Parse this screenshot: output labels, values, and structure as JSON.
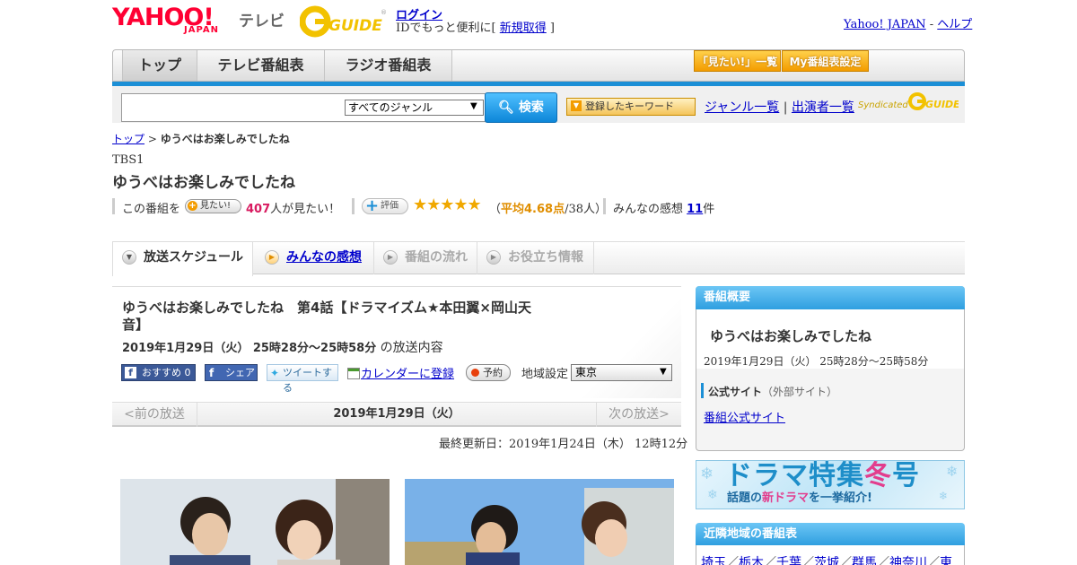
{
  "header": {
    "logo_yahoo": "YAHOO!",
    "logo_japan": "JAPAN",
    "logo_tv": "テレビ",
    "logo_gguide": "G-GUIDE",
    "login_link": "ログイン",
    "login_sub_prefix": "IDでもっと便利に[ ",
    "register_link": "新規取得",
    "login_sub_suffix": " ]",
    "yahoo_japan_link": "Yahoo! JAPAN",
    "separator": " - ",
    "help_link": "ヘルプ"
  },
  "global_nav": {
    "tabs": [
      "トップ",
      "テレビ番組表",
      "ラジオ番組表"
    ],
    "mitai_list": "「見たい!」一覧",
    "my_settings": "My番組表設定"
  },
  "search": {
    "genre_selected": "すべてのジャンル",
    "button": "検索",
    "registered_keywords": "登録したキーワード",
    "genre_list": "ジャンル一覧",
    "divider": " | ",
    "cast_list": "出演者一覧",
    "syndicated": "Syndicated"
  },
  "breadcrumb": {
    "top": "トップ",
    "sep": " > ",
    "current": "ゆうべはお楽しみでしたね"
  },
  "program": {
    "channel": "TBS1",
    "title": "ゆうべはお楽しみでしたね",
    "mitai_prefix": "この番組を",
    "mitai_button": "見たい!",
    "mitai_count": "407",
    "mitai_suffix": "人が見たい！",
    "rate_button": "評価",
    "stars": "★★★★★",
    "rating_open": "（",
    "rating_average": "平均4.68点",
    "rating_people": "/38人）",
    "impressions_prefix": "みんなの感想 ",
    "impressions_count": "11",
    "impressions_suffix": "件"
  },
  "tabs": {
    "schedule": "放送スケジュール",
    "impressions": "みんなの感想",
    "flow": "番組の流れ",
    "info": "お役立ち情報"
  },
  "episode": {
    "title": "ゆうべはお楽しみでしたね　第4話【ドラマイズム★本田翼×岡山天音】",
    "time": "2019年1月29日（火）  25時28分～25時58分",
    "time_suffix": " の放送内容",
    "fb_recommend": "おすすめ 0",
    "fb_share": "シェア",
    "tweet": "ツイートする",
    "calendar": "カレンダーに登録",
    "reserve": "予約",
    "region_label": "地域設定",
    "region_selected": "東京",
    "prev": "<前の放送",
    "date": "2019年1月29日（火）",
    "next": "次の放送>",
    "last_updated": "最終更新日：2019年1月24日（木）  12時12分"
  },
  "sidebar": {
    "overview_header": "番組概要",
    "overview_title": "ゆうべはお楽しみでしたね",
    "overview_time": "2019年1月29日（火）  25時28分～25時58分",
    "official_label": "公式サイト",
    "official_note": "（外部サイト）",
    "official_link": "番組公式サイト",
    "drama_title_a": "ドラマ特集",
    "drama_title_b": "冬",
    "drama_title_c": "号",
    "drama_sub_a": "話題の",
    "drama_sub_b": "新ドラマ",
    "drama_sub_c": "を一挙紹介!",
    "nearby_header": "近隣地域の番組表",
    "nearby_regions": [
      "埼玉",
      "栃木",
      "千葉",
      "茨城",
      "群馬",
      "神奈川",
      "東"
    ]
  },
  "colors": {
    "accent_blue": "#1b8fd6",
    "yahoo_red": "#ff0033",
    "link": "#0000cc",
    "mitai_pink": "#d81b60",
    "star_gold": "#f0a800"
  }
}
